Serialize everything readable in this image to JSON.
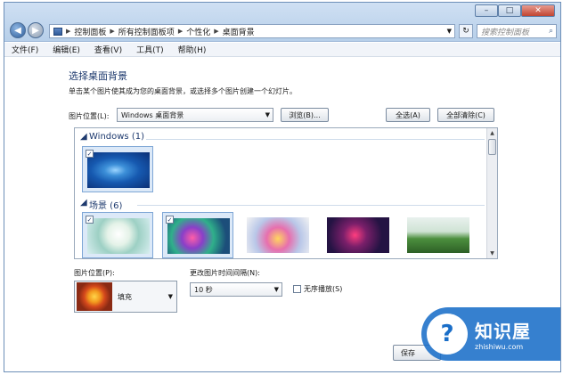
{
  "window": {
    "breadcrumbs": [
      "控制面板",
      "所有控制面板项",
      "个性化",
      "桌面背景"
    ],
    "search_placeholder": "搜索控制面板",
    "controls": {
      "minimize": "–",
      "maximize": "□",
      "close": "✕"
    }
  },
  "menu": [
    "文件(F)",
    "编辑(E)",
    "查看(V)",
    "工具(T)",
    "帮助(H)"
  ],
  "page": {
    "title": "选择桌面背景",
    "description": "单击某个图片使其成为您的桌面背景，或选择多个图片创建一个幻灯片。"
  },
  "location": {
    "label": "图片位置(L):",
    "value": "Windows 桌面背景",
    "browse": "浏览(B)...",
    "select_all": "全选(A)",
    "clear_all": "全部清除(C)"
  },
  "gallery": {
    "groups": [
      {
        "title": "Windows (1)",
        "items": [
          {
            "checked": true,
            "name": "windows-7-default-wallpaper"
          }
        ]
      },
      {
        "title": "场景 (6)",
        "items": [
          {
            "checked": true,
            "name": "scene-wallpaper-1"
          },
          {
            "checked": true,
            "name": "scene-wallpaper-2"
          },
          {
            "checked": false,
            "name": "scene-wallpaper-3"
          },
          {
            "checked": false,
            "name": "scene-wallpaper-4"
          },
          {
            "checked": false,
            "name": "scene-wallpaper-5"
          }
        ]
      }
    ]
  },
  "position": {
    "label": "图片位置(P):",
    "value": "填充"
  },
  "interval": {
    "label": "更改图片时间间隔(N):",
    "value": "10 秒"
  },
  "shuffle": {
    "label": "无序播放(S)",
    "checked": false
  },
  "footer": {
    "save_label": "保存"
  },
  "watermark": {
    "brand": "知识屋",
    "url": "zhishiwu.com"
  },
  "colors": {
    "accent": "#1e3a6e",
    "titlebar": "#b7cfe9",
    "watermark": "#1a6ec8"
  }
}
